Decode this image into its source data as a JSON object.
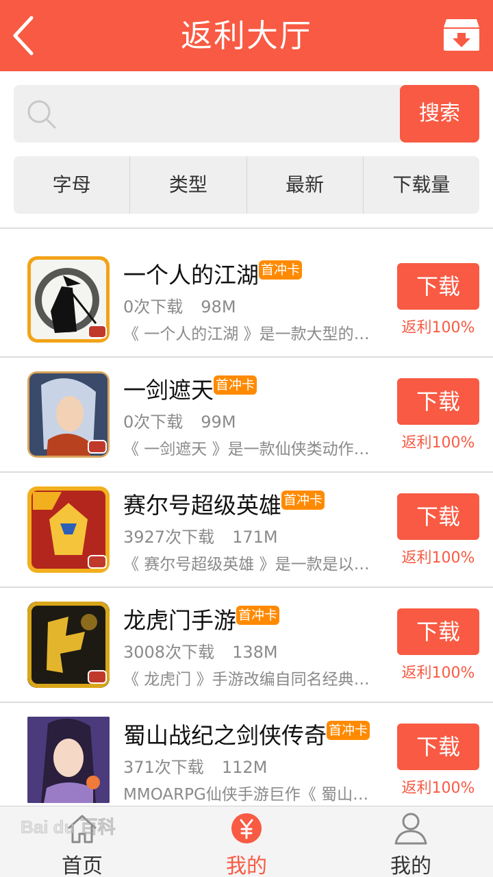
{
  "header": {
    "title": "返利大厅",
    "back_icon": "chevron-left-icon",
    "download_box_icon": "download-box-icon"
  },
  "search": {
    "placeholder": "",
    "value": "",
    "button_label": "搜索",
    "icon": "search-icon"
  },
  "filters": [
    "字母",
    "类型",
    "最新",
    "下载量"
  ],
  "games": [
    {
      "name": "一个人的江湖",
      "tag": "首冲卡",
      "downloads": "0次下载",
      "size": "98M",
      "desc": "《 一个人的江湖 》是一款大型的卡...",
      "button": "下载",
      "rebate": "返利100%"
    },
    {
      "name": "一剑遮天",
      "tag": "首冲卡",
      "downloads": "0次下载",
      "size": "99M",
      "desc": "《 一剑遮天 》是一款仙侠类动作手...",
      "button": "下载",
      "rebate": "返利100%"
    },
    {
      "name": "赛尔号超级英雄",
      "tag": "首冲卡",
      "downloads": "3927次下载",
      "size": "171M",
      "desc": "《 赛尔号超级英雄 》是一款是以热...",
      "button": "下载",
      "rebate": "返利100%"
    },
    {
      "name": "龙虎门手游",
      "tag": "首冲卡",
      "downloads": "3008次下载",
      "size": "138M",
      "desc": "《 龙虎门 》手游改编自同名经典港...",
      "button": "下载",
      "rebate": "返利100%"
    },
    {
      "name": "蜀山战纪之剑侠传奇",
      "tag": "首冲卡",
      "downloads": "371次下载",
      "size": "112M",
      "desc": "MMOARPG仙侠手游巨作《 蜀山战...",
      "button": "下载",
      "rebate": "返利100%"
    }
  ],
  "tabbar": [
    {
      "label": "首页",
      "icon": "home-icon"
    },
    {
      "label": "我的",
      "icon": "yuan-coin-icon"
    },
    {
      "label": "我的",
      "icon": "user-icon"
    }
  ],
  "watermark": "Bai du 百科",
  "colors": {
    "accent": "#f85a43",
    "tag": "#ff8a00",
    "muted": "#8a8a8a"
  }
}
